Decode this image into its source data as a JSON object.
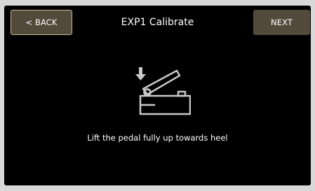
{
  "header": {
    "back_label": "< BACK",
    "title": "EXP1 Calibrate",
    "next_label": "NEXT"
  },
  "main": {
    "illustration_icon": "expression-pedal-heel-up-icon",
    "instruction": "Lift the pedal fully up towards heel"
  },
  "colors": {
    "background": "#000000",
    "button": "#524a3b",
    "button_selected_border": "#c8b89a",
    "icon": "#c9c9c9",
    "text": "#ffffff"
  }
}
